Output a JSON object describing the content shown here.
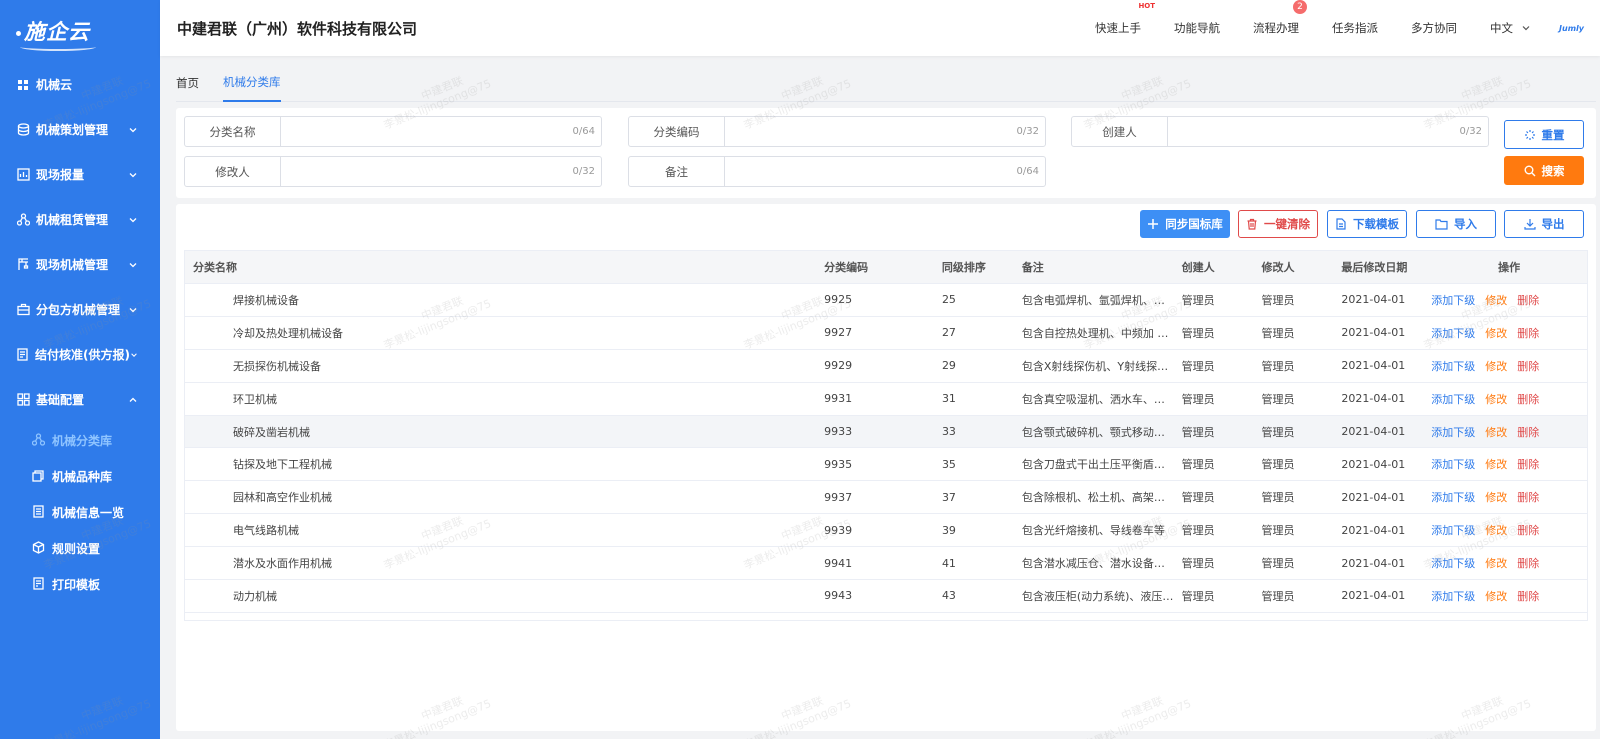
{
  "sidebar": {
    "logo": "施企云",
    "items": [
      {
        "label": "机械云"
      },
      {
        "label": "机械策划管理"
      },
      {
        "label": "现场报量"
      },
      {
        "label": "机械租赁管理"
      },
      {
        "label": "现场机械管理"
      },
      {
        "label": "分包方机械管理"
      },
      {
        "label": "结付核准(供方报)"
      },
      {
        "label": "基础配置"
      }
    ],
    "sub_items": [
      {
        "label": "机械分类库"
      },
      {
        "label": "机械品种库"
      },
      {
        "label": "机械信息一览"
      },
      {
        "label": "规则设置"
      },
      {
        "label": "打印模板"
      }
    ]
  },
  "header": {
    "company": "中建君联（广州）软件科技有限公司",
    "nav": [
      "快速上手",
      "功能导航",
      "流程办理",
      "任务指派",
      "多方协同"
    ],
    "hot": "HOT",
    "badge": "2",
    "lang": "中文",
    "avatar": "Jumly"
  },
  "tabs": [
    "首页",
    "机械分类库"
  ],
  "filters": [
    {
      "label": "分类名称",
      "count": "0/64"
    },
    {
      "label": "分类编码",
      "count": "0/32"
    },
    {
      "label": "创建人",
      "count": "0/32"
    },
    {
      "label": "修改人",
      "count": "0/32"
    },
    {
      "label": "备注",
      "count": "0/64"
    }
  ],
  "buttons": {
    "reset": "重置",
    "search": "搜索"
  },
  "toolbar": {
    "sync": "同步国标库",
    "clear": "一键清除",
    "template": "下载模板",
    "import": "导入",
    "export": "导出"
  },
  "table": {
    "headers": [
      "分类名称",
      "分类编码",
      "同级排序",
      "备注",
      "创建人",
      "修改人",
      "最后修改日期",
      "操作"
    ],
    "ops": {
      "add": "添加下级",
      "edit": "修改",
      "del": "删除"
    },
    "rows": [
      [
        "焊接机械设备",
        "9925",
        "25",
        "包含电弧焊机、氩弧焊机、二…",
        "管理员",
        "管理员",
        "2021-04-01"
      ],
      [
        "冷却及热处理机械设备",
        "9927",
        "27",
        "包含自控热处理机、中频加 热…",
        "管理员",
        "管理员",
        "2021-04-01"
      ],
      [
        "无损探伤机械设备",
        "9929",
        "29",
        "包含X射线探伤机、Y射线探伤…",
        "管理员",
        "管理员",
        "2021-04-01"
      ],
      [
        "环卫机械",
        "9931",
        "31",
        "包含真空吸湿机、洒水车、引…",
        "管理员",
        "管理员",
        "2021-04-01"
      ],
      [
        "破碎及凿岩机械",
        "9933",
        "33",
        "包含颚式破碎机、颚式移动破…",
        "管理员",
        "管理员",
        "2021-04-01"
      ],
      [
        "钻探及地下工程机械",
        "9935",
        "35",
        "包含刀盘式干出土压平衡盾构…",
        "管理员",
        "管理员",
        "2021-04-01"
      ],
      [
        "园林和高空作业机械",
        "9937",
        "37",
        "包含除根机、松土机、高架车等",
        "管理员",
        "管理员",
        "2021-04-01"
      ],
      [
        "电气线路机械",
        "9939",
        "39",
        "包含光纤熔接机、导线卷车等",
        "管理员",
        "管理员",
        "2021-04-01"
      ],
      [
        "潜水及水面作用机械",
        "9941",
        "41",
        "包含潜水减压仓、潜水设备、…",
        "管理员",
        "管理员",
        "2021-04-01"
      ],
      [
        "动力机械",
        "9943",
        "43",
        "包含液压柜(动力系统)、液压…",
        "管理员",
        "管理员",
        "2021-04-01"
      ]
    ]
  },
  "watermark": {
    "line1": "中建君联",
    "line2": "李景松-lijingsong@75"
  }
}
